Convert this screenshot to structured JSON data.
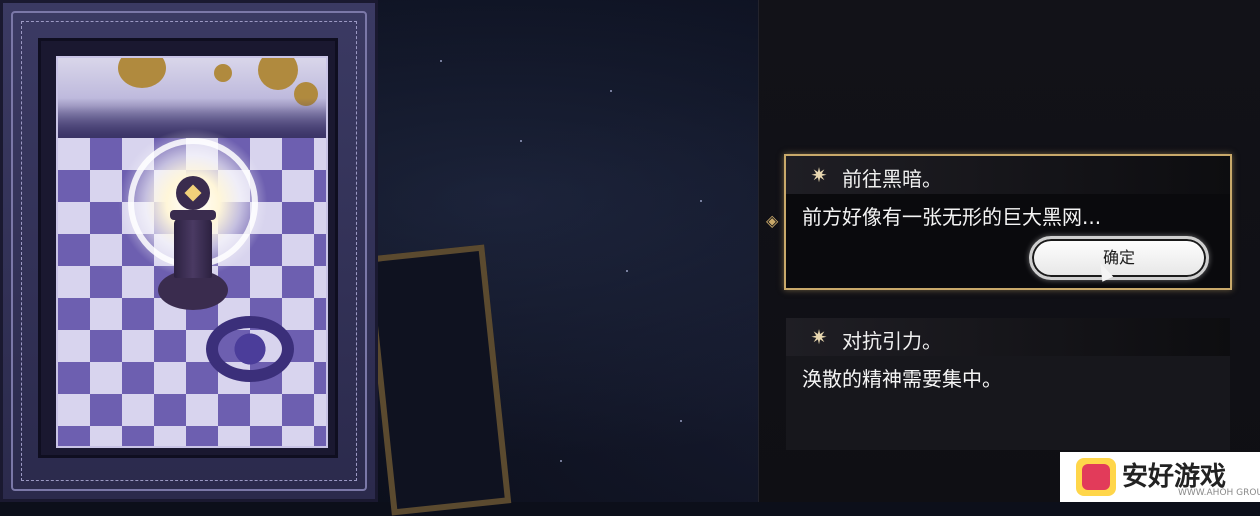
{
  "dialog": {
    "options": [
      {
        "title": "前往黑暗。",
        "body": "前方好像有一张无形的巨大黑网...",
        "confirm_label": "确定",
        "selected": true
      },
      {
        "title": "对抗引力。",
        "body": "涣散的精神需要集中。",
        "selected": false
      }
    ]
  },
  "watermark": {
    "text": "安好游戏",
    "subtext": "WWW.AHOH GROUP"
  },
  "colors": {
    "accent_gold": "#c9a96a",
    "panel_bg": "#0f0f14",
    "card_frame": "#3b3a63"
  }
}
